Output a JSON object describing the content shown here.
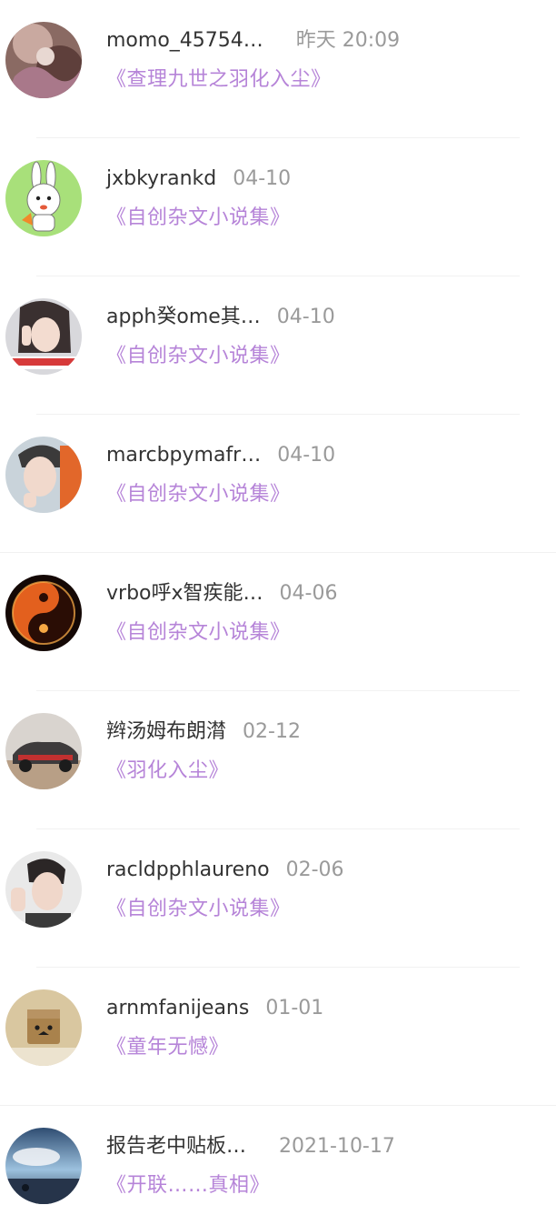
{
  "comments": [
    {
      "user": "momo_45754…",
      "time": "昨天 20:09",
      "book": "《查理九世之羽化入尘》",
      "avatar_icon": "fantasy-art-avatar"
    },
    {
      "user": "jxbkyrankd",
      "time": "04-10",
      "book": "《自创杂文小说集》",
      "avatar_icon": "cartoon-rabbit-avatar"
    },
    {
      "user": "apph癸ome其…",
      "time": "04-10",
      "book": "《自创杂文小说集》",
      "avatar_icon": "girl-peace-sign-avatar"
    },
    {
      "user": "marcbpymafr…",
      "time": "04-10",
      "book": "《自创杂文小说集》",
      "avatar_icon": "boy-portrait-avatar"
    },
    {
      "user": "vrbo呼x智疾能…",
      "time": "04-06",
      "book": "《自创杂文小说集》",
      "avatar_icon": "fire-yin-yang-avatar"
    },
    {
      "user": "辫汤姆布朗潸",
      "time": "02-12",
      "book": "《羽化入尘》",
      "avatar_icon": "vintage-car-avatar"
    },
    {
      "user": "racldpphlaureno",
      "time": "02-06",
      "book": "《自创杂文小说集》",
      "avatar_icon": "boy-peace-sign-avatar"
    },
    {
      "user": "arnmfanijeans",
      "time": "01-01",
      "book": "《童年无憾》",
      "avatar_icon": "cardboard-box-toy-avatar"
    },
    {
      "user": "报告老中贴板…",
      "time": "2021-10-17",
      "book": "《开联……真相》",
      "avatar_icon": "sunset-sky-avatar"
    }
  ],
  "colors": {
    "username": "#333333",
    "time": "#9a9a9a",
    "book_link": "#b684d8",
    "divider": "#f1f1f1"
  }
}
